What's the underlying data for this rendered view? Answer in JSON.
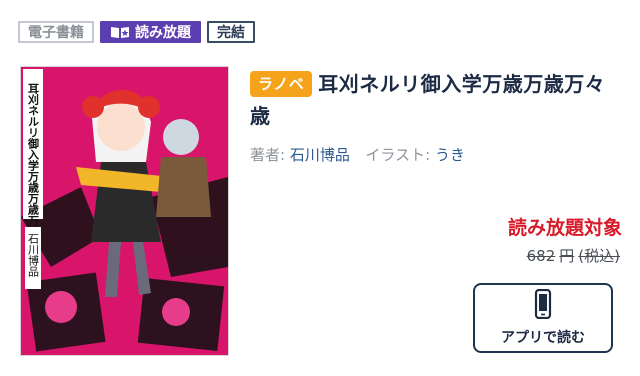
{
  "badges": {
    "ebook": "電子書籍",
    "unlimited": "読み放題",
    "complete": "完結"
  },
  "book": {
    "label": "ラノベ",
    "title": "耳刈ネルリ御入学万歳万歳万々歳",
    "author_label": "著者:",
    "author": "石川博品",
    "illustrator_label": "イラスト:",
    "illustrator": "うき"
  },
  "cover_text": {
    "spine_title": "耳刈ネルリ御入学万歳万歳万々歳",
    "author": "石川博品"
  },
  "pricing": {
    "unlimited_target": "読み放題対象",
    "price": "682",
    "currency": "円",
    "tax": "(税込)"
  },
  "app_button": {
    "label": "アプリで読む",
    "icon": "smartphone-icon"
  },
  "colors": {
    "accent_orange": "#f5a31a",
    "unlimited_purple": "#5b3fb0",
    "sale_red": "#d81b2a",
    "link_blue": "#2c5a8d"
  }
}
